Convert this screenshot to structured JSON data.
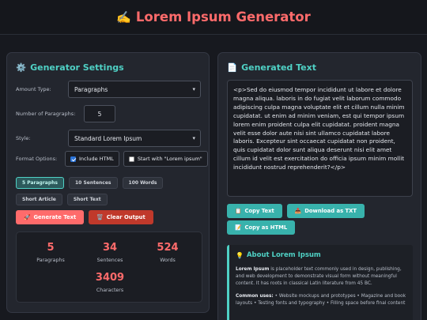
{
  "header": {
    "emoji": "✍️",
    "title": "Lorem Ipsum Generator"
  },
  "settings": {
    "icon": "⚙️",
    "title": "Generator Settings",
    "amount_type_label": "Amount Type:",
    "amount_type_value": "Paragraphs",
    "num_label": "Number of Paragraphs:",
    "num_value": "5",
    "style_label": "Style:",
    "style_value": "Standard Lorem Ipsum",
    "format_label": "Format Options:",
    "include_html_label": "Include HTML",
    "include_html_checked": true,
    "start_with_label": "Start with \"Lorem ipsum\"",
    "start_with_checked": false,
    "presets": [
      "5 Paragraphs",
      "10 Sentences",
      "100 Words",
      "Short Article",
      "Short Text"
    ],
    "active_preset": "5 Paragraphs",
    "generate_icon": "🚀",
    "generate_label": "Generate Text",
    "clear_icon": "🗑️",
    "clear_label": "Clear Output"
  },
  "stats": {
    "paragraphs": {
      "value": "5",
      "label": "Paragraphs"
    },
    "sentences": {
      "value": "34",
      "label": "Sentences"
    },
    "words": {
      "value": "524",
      "label": "Words"
    },
    "characters": {
      "value": "3409",
      "label": "Characters"
    }
  },
  "output": {
    "icon": "📄",
    "title": "Generated Text",
    "text": "<p>Sed do eiusmod tempor incididunt ut labore et dolore magna aliqua. laboris in do fugiat velit laborum commodo adipiscing culpa magna voluptate elit et cillum nulla minim cupidatat. ut enim ad minim veniam, est qui tempor ipsum lorem enim proident culpa elit cupidatat. proident magna velit esse dolor aute nisi sint ullamco cupidatat labore laboris. Excepteur sint occaecat cupidatat non proident, quis cupidatat dolor sunt aliqua deserunt nisi elit amet cillum id velit est exercitation do officia ipsum minim mollit incididunt nostrud reprehenderit?</p>",
    "copy_icon": "📋",
    "copy_label": "Copy Text",
    "download_icon": "📥",
    "download_label": "Download as TXT",
    "copy_html_icon": "📝",
    "copy_html_label": "Copy as HTML"
  },
  "about": {
    "icon": "💡",
    "title": "About Lorem Ipsum",
    "p1_bold": "Lorem Ipsum",
    "p1_text": " is placeholder text commonly used in design, publishing, and web development to demonstrate visual form without meaningful content. It has roots in classical Latin literature from 45 BC.",
    "p2_bold": "Common uses:",
    "p2_text": " • Website mockups and prototypes • Magazine and book layouts • Testing fonts and typography • Filling space before final content"
  },
  "colors": {
    "accent_red": "#ff6b6b",
    "accent_teal": "#4fd1c5",
    "background": "#17191f"
  }
}
